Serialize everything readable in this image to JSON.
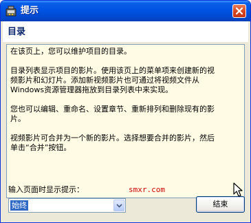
{
  "window": {
    "title": "提示"
  },
  "header": {
    "heading": "目录"
  },
  "help_text": {
    "paragraphs": [
      "在该页上，您可以维护项目的目录。",
      "目录列表显示项目的影片。使用该页上的菜单项来创建新的视\n频影片和幻灯片。添加新视频影片也可通过将视频文件从\nWindows资源管理器拖放到目录列表中来实现。",
      "您也可以编辑、重命名、设置章节、重新排列和删除现有的影\n片。",
      "视频影片可合并为一个新的影片。选择想要合并的影片，然后\n单击“合并”按钮。"
    ]
  },
  "footer": {
    "hint_label": "输入页面时显示提示：",
    "hint_select_value": "始终",
    "finish_button": "结束",
    "watermark": "smxr.com"
  },
  "icons": {
    "title_icon": "app-icon",
    "close": "close-icon",
    "dropdown": "chevron-down-icon",
    "cursor": "mouse-pointer-icon"
  },
  "colors": {
    "titlebar": "#0054e3",
    "close_button": "#d6441c",
    "dialog_face": "#ece9d8",
    "textbox_bg": "#fffbe5",
    "heading": "#0a246a",
    "watermark": "#d00000",
    "selection": "#316ac5"
  }
}
